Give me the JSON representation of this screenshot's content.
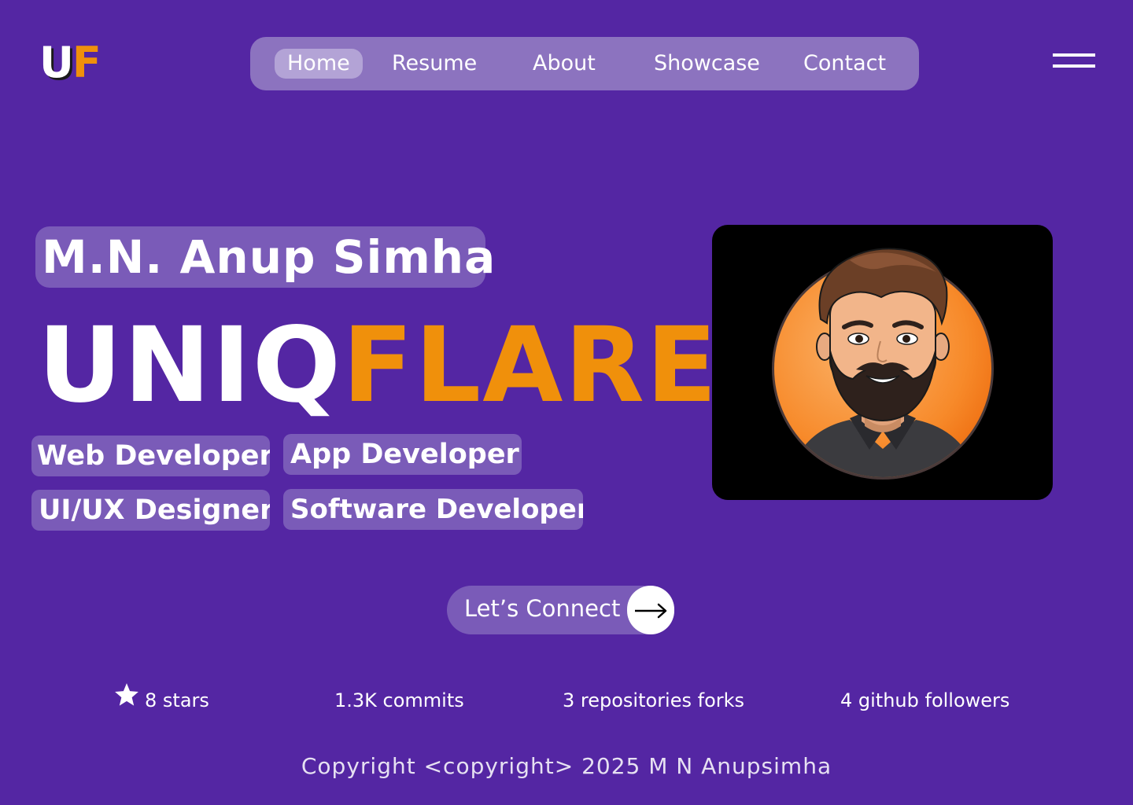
{
  "logo": {
    "letter_one": "U",
    "letter_two": "F"
  },
  "nav": {
    "items": [
      {
        "label": "Home",
        "active": true
      },
      {
        "label": "Resume",
        "active": false
      },
      {
        "label": "About",
        "active": false
      },
      {
        "label": "Showcase",
        "active": false
      },
      {
        "label": "Contact",
        "active": false
      }
    ]
  },
  "menu_icon": "hamburger-menu-icon",
  "hero": {
    "name": "M.N. Anup Simha",
    "brand_primary": "UNIQ",
    "brand_secondary": "FLARE",
    "brand_dot": ".",
    "roles": [
      "Web Developer",
      "App Developer",
      "UI/UX Designer",
      "Software Developer"
    ]
  },
  "avatar": {
    "icon": "bearded-man-avatar-illustration"
  },
  "cta": {
    "label": "Let’s Connect",
    "icon": "arrow-right-icon"
  },
  "stats": {
    "stars": "8 stars",
    "commits": "1.3K commits",
    "forks": "3 repositories forks",
    "followers": "4 github followers",
    "star_icon": "star-icon"
  },
  "footer": {
    "copyright": "Copyright <copyright> 2025 M N Anupsimha"
  },
  "colors": {
    "background": "#5426a3",
    "nav_bg": "#8c73bf",
    "chip_bg": "#7a5bb8",
    "accent_orange": "#f0900b",
    "text": "#ffffff"
  }
}
